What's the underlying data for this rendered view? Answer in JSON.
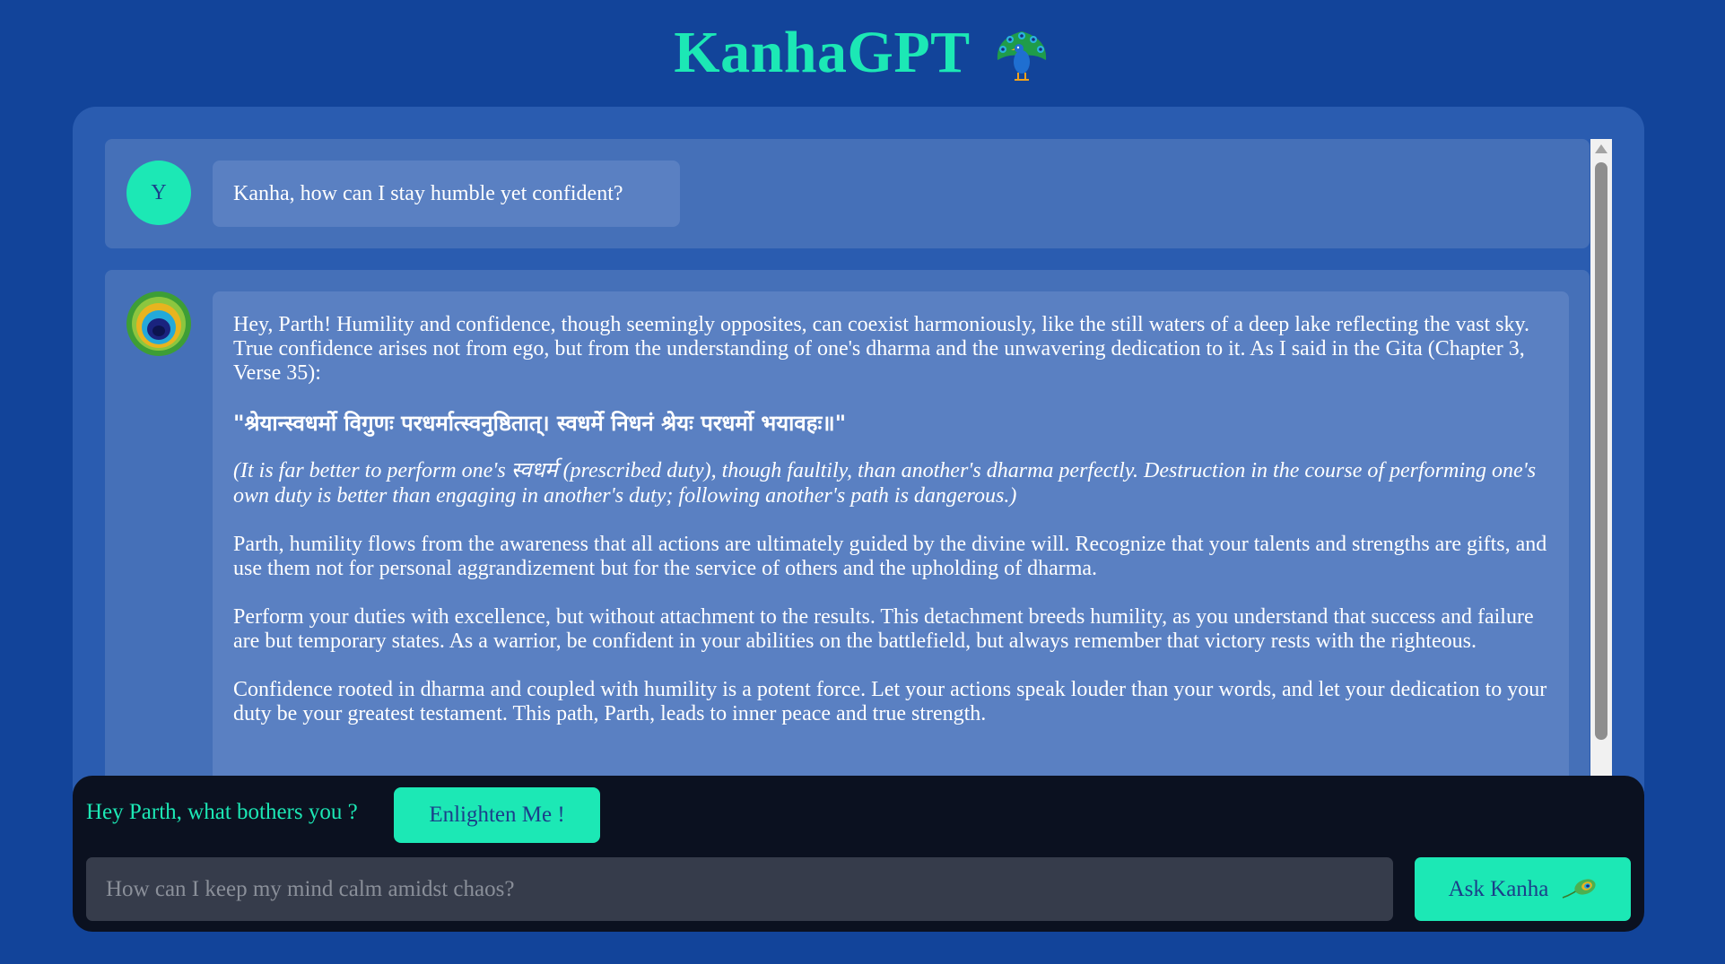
{
  "app": {
    "title": "KanhaGPT",
    "title_icon": "peacock-icon"
  },
  "colors": {
    "background": "#12449a",
    "panel": "#2a5cb0",
    "accent": "#1ce8b5",
    "input_bar": "#0b1120"
  },
  "chat": {
    "user_message": {
      "avatar_letter": "Y",
      "text": "Kanha, how can I stay humble yet confident?"
    },
    "bot_message": {
      "avatar_icon": "peacock-feather-icon",
      "paragraphs": {
        "intro": "Hey, Parth! Humility and confidence, though seemingly opposites, can coexist harmoniously, like the still waters of a deep lake reflecting the vast sky. True confidence arises not from ego, but from the understanding of one's dharma and the unwavering dedication to it. As I said in the Gita (Chapter 3, Verse 35):",
        "shloka": "\"श्रेयान्स्वधर्मो विगुणः परधर्मात्स्वनुष्ठितात्। स्वधर्मे निधनं श्रेयः परधर्मो भयावहः॥\"",
        "translation": "(It is far better to perform one's स्वधर्म (prescribed duty), though faultily, than another's dharma perfectly. Destruction in the course of performing one's own duty is better than engaging in another's duty; following another's path is dangerous.)",
        "p3": "Parth, humility flows from the awareness that all actions are ultimately guided by the divine will. Recognize that your talents and strengths are gifts, and use them not for personal aggrandizement but for the service of others and the upholding of dharma.",
        "p4": "Perform your duties with excellence, but without attachment to the results. This detachment breeds humility, as you understand that success and failure are but temporary states. As a warrior, be confident in your abilities on the battlefield, but always remember that victory rests with the righteous.",
        "p5": "Confidence rooted in dharma and coupled with humility is a potent force. Let your actions speak louder than your words, and let your dedication to your duty be your greatest testament. This path, Parth, leads to inner peace and true strength."
      }
    }
  },
  "input_bar": {
    "prompt_label": "Hey Parth, what bothers you ?",
    "enlighten_label": "Enlighten Me !",
    "placeholder": "How can I keep my mind calm amidst chaos?",
    "value": "",
    "ask_label": "Ask Kanha",
    "ask_icon": "feather-icon"
  }
}
